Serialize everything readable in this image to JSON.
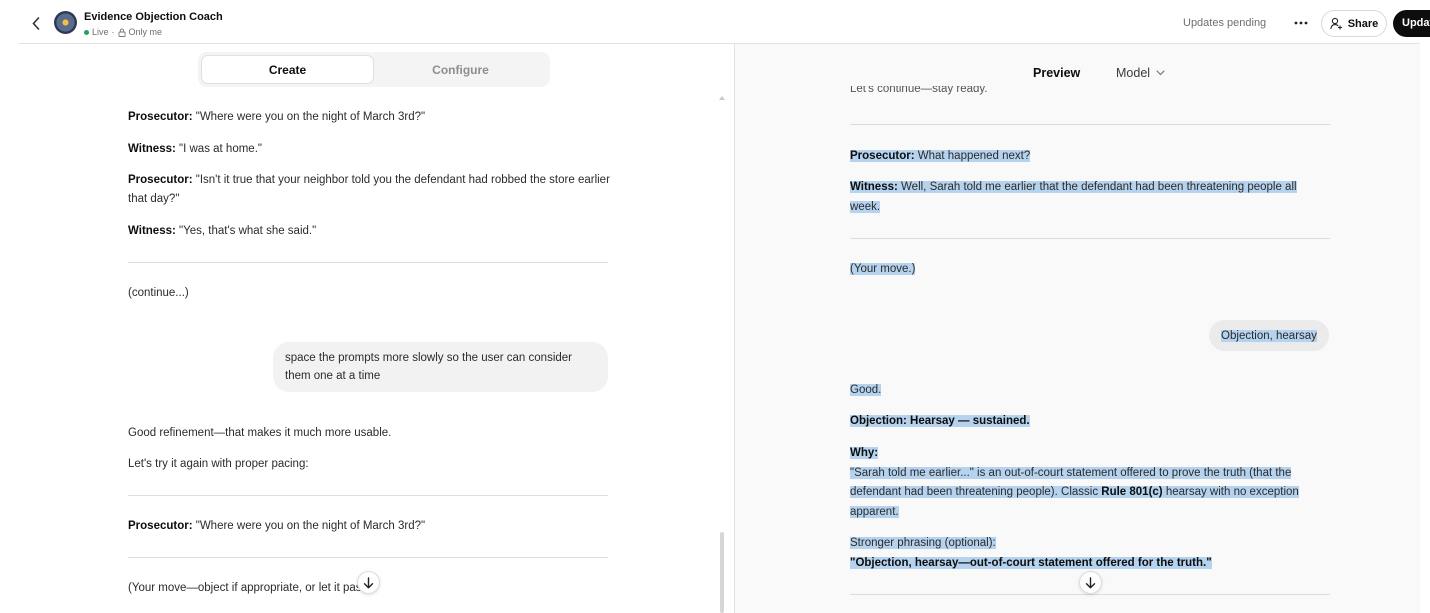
{
  "header": {
    "title": "Evidence Objection Coach",
    "status": "Live",
    "visibility": "Only me",
    "updates_pending": "Updates pending",
    "share_label": "Share",
    "update_label": "Update"
  },
  "builder": {
    "tabs": [
      {
        "label": "Create",
        "active": true
      },
      {
        "label": "Configure",
        "active": false
      }
    ],
    "messages": [
      {
        "speaker": "Prosecutor:",
        "text": " \"Where were you on the night of March 3rd?\""
      },
      {
        "speaker": "Witness:",
        "text": " \"I was at home.\""
      },
      {
        "speaker": "Prosecutor:",
        "text": " \"Isn't it true that your neighbor told you the defendant had robbed the store earlier that day?\""
      },
      {
        "speaker": "Witness:",
        "text": " \"Yes, that's what she said.\""
      }
    ],
    "continue_text": "(continue...)",
    "user_message": "space the prompts more slowly so the user can consider them one at a time",
    "reply_1": "Good refinement—that makes it much more usable.",
    "reply_2": "Let's try it again with proper pacing:",
    "msg2": {
      "speaker": "Prosecutor:",
      "text": " \"Where were you on the night of March 3rd?\""
    },
    "your_move": "(Your move—object if appropriate, or let it pass.)"
  },
  "preview": {
    "tabs": {
      "preview": "Preview",
      "model": "Model"
    },
    "cut_text": "Let's continue—stay ready.",
    "q": {
      "speaker": "Prosecutor:",
      "text": " What happened next?"
    },
    "a": {
      "speaker": "Witness:",
      "text": " Well, Sarah told me earlier that the defendant had been threatening people all week."
    },
    "your_move": "(Your move.)",
    "user_message": "Objection, hearsay",
    "good": "Good.",
    "ruling": "Objection: Hearsay — sustained.",
    "why_label": "Why:",
    "why_part1": "\"Sarah told me earlier...\" is an out-of-court statement offered to prove the truth (that the defendant had been threatening people). Classic ",
    "why_rule": "Rule 801(c)",
    "why_part2": " hearsay with no exception apparent.",
    "stronger_label": "Stronger phrasing (optional):",
    "stronger_text": "\"Objection, hearsay—out-of-court statement offered for the truth.\""
  },
  "colors": {
    "highlight": "#b5d3ee",
    "live": "#22a35a"
  }
}
